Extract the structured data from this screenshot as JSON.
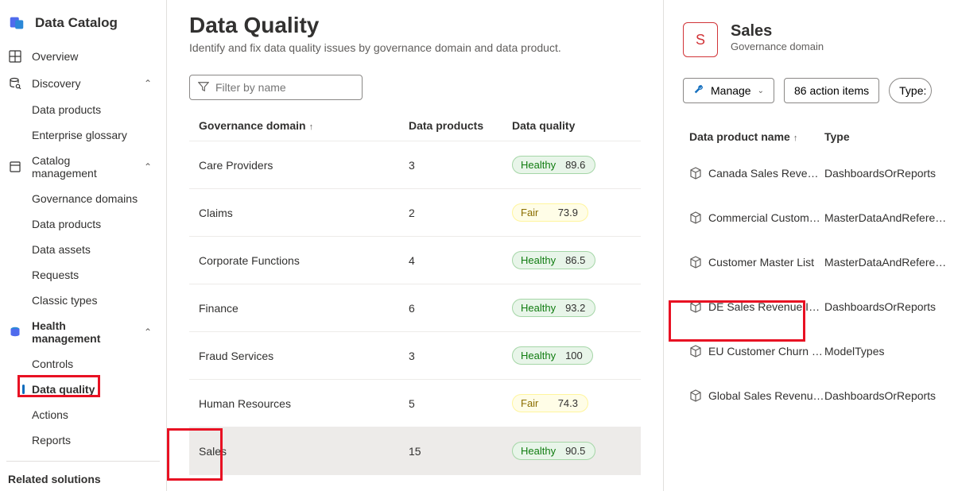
{
  "brand": {
    "title": "Data Catalog"
  },
  "nav": {
    "overview": "Overview",
    "discovery": "Discovery",
    "discovery_children": {
      "data_products": "Data products",
      "enterprise_glossary": "Enterprise glossary"
    },
    "catalog_mgmt": "Catalog management",
    "catalog_mgmt_children": {
      "governance_domains": "Governance domains",
      "data_products": "Data products",
      "data_assets": "Data assets",
      "requests": "Requests",
      "classic_types": "Classic types"
    },
    "health_mgmt": "Health management",
    "health_mgmt_children": {
      "controls": "Controls",
      "data_quality": "Data quality",
      "actions": "Actions",
      "reports": "Reports"
    },
    "related": "Related solutions"
  },
  "page": {
    "title": "Data Quality",
    "subtitle": "Identify and fix data quality issues by governance domain and data product."
  },
  "filter": {
    "placeholder": "Filter by name"
  },
  "table": {
    "col_domain": "Governance domain",
    "col_products": "Data products",
    "col_quality": "Data quality",
    "rows": [
      {
        "name": "Care Providers",
        "count": "3",
        "status": "Healthy",
        "score": "89.6",
        "cls": "healthy"
      },
      {
        "name": "Claims",
        "count": "2",
        "status": "Fair",
        "score": "73.9",
        "cls": "fair"
      },
      {
        "name": "Corporate Functions",
        "count": "4",
        "status": "Healthy",
        "score": "86.5",
        "cls": "healthy"
      },
      {
        "name": "Finance",
        "count": "6",
        "status": "Healthy",
        "score": "93.2",
        "cls": "healthy"
      },
      {
        "name": "Fraud Services",
        "count": "3",
        "status": "Healthy",
        "score": "100",
        "cls": "healthy"
      },
      {
        "name": "Human Resources",
        "count": "5",
        "status": "Fair",
        "score": "74.3",
        "cls": "fair"
      },
      {
        "name": "Sales",
        "count": "15",
        "status": "Healthy",
        "score": "90.5",
        "cls": "healthy"
      }
    ]
  },
  "detail": {
    "badge_letter": "S",
    "title": "Sales",
    "subtitle": "Governance domain",
    "manage_label": "Manage",
    "action_items_label": "86 action items",
    "type_filter_label": "Type:",
    "col_name": "Data product name",
    "col_type": "Type",
    "rows": [
      {
        "name": "Canada Sales Reven…",
        "type": "DashboardsOrReports"
      },
      {
        "name": "Commercial Custom…",
        "type": "MasterDataAndReferen…"
      },
      {
        "name": "Customer Master List",
        "type": "MasterDataAndReferen…"
      },
      {
        "name": "DE Sales Revenue In…",
        "type": "DashboardsOrReports"
      },
      {
        "name": "EU Customer Churn …",
        "type": "ModelTypes"
      },
      {
        "name": "Global Sales Revenu…",
        "type": "DashboardsOrReports"
      }
    ]
  }
}
